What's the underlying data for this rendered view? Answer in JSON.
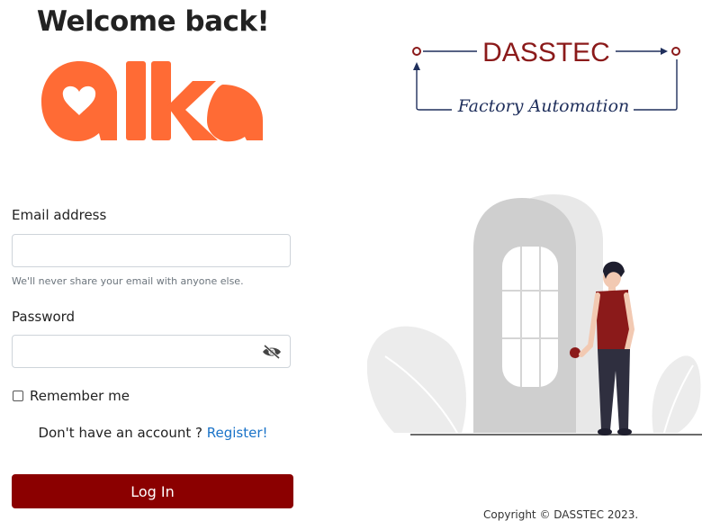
{
  "header": {
    "welcome": "Welcome back!"
  },
  "brand": {
    "alka_logo": "alka",
    "alka_color": "#ff6b35"
  },
  "partner": {
    "name": "DASSTEC",
    "tagline": "Factory Automation",
    "name_color": "#8b1a1a",
    "line_color": "#1f2f5c"
  },
  "form": {
    "email_label": "Email address",
    "email_value": "",
    "email_placeholder": "",
    "email_hint": "We'll never share your email with anyone else.",
    "password_label": "Password",
    "password_value": "",
    "password_placeholder": "",
    "toggle_icon": "eye-slash-icon",
    "remember_label": "Remember me",
    "remember_checked": false,
    "register_prompt": "Don't have an account ?",
    "register_link": "Register!",
    "login_label": "Log In",
    "accent": "#8b0000"
  },
  "footer": {
    "copyright": "Copyright © DASSTEC 2023."
  }
}
